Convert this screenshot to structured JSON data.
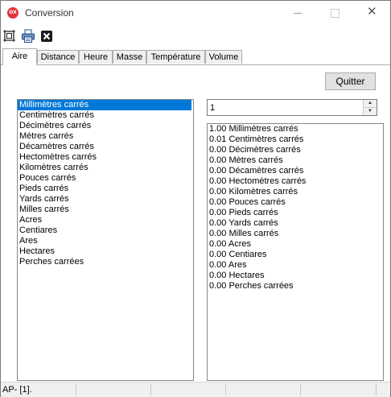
{
  "window": {
    "icon_text": "OX",
    "title": "Conversion"
  },
  "toolbar": {
    "icons": [
      "fit-icon",
      "print-icon",
      "close-icon"
    ]
  },
  "tabs": [
    {
      "label": "Aire",
      "active": true
    },
    {
      "label": "Distance",
      "active": false
    },
    {
      "label": "Heure",
      "active": false
    },
    {
      "label": "Masse",
      "active": false
    },
    {
      "label": "Température",
      "active": false
    },
    {
      "label": "Volume",
      "active": false
    }
  ],
  "quit_label": "Quitter",
  "units": [
    "Millimètres carrés",
    "Centimètres carrés",
    "Décimètres carrés",
    "Mètres carrés",
    "Décamètres carrés",
    "Hectomètres carrés",
    "Kilomètres carrés",
    "Pouces carrés",
    "Pieds carrés",
    "Yards carrés",
    "Milles carrés",
    "Acres",
    "Centiares",
    "Ares",
    "Hectares",
    "Perches carrées"
  ],
  "selected_unit_index": 0,
  "quantity": "1",
  "results": [
    "1.00 Millimètres carrés",
    "0.01 Centimètres carrés",
    "0.00 Décimètres carrés",
    "0.00 Mètres carrés",
    "0.00 Décamètres carrés",
    "0.00 Hectomètres carrés",
    "0.00 Kilomètres carrés",
    "0.00 Pouces carrés",
    "0.00 Pieds carrés",
    "0.00 Yards carrés",
    "0.00 Milles carrés",
    "0.00 Acres",
    "0.00 Centiares",
    "0.00 Ares",
    "0.00 Hectares",
    "0.00 Perches carrées"
  ],
  "status": "AP- [1]."
}
